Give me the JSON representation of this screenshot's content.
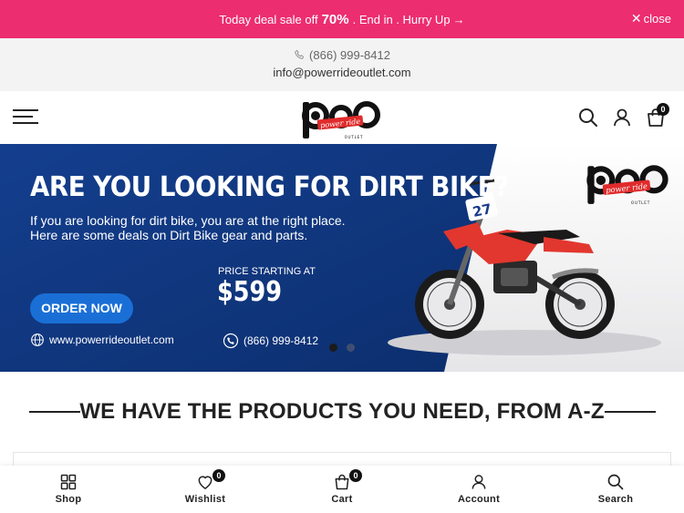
{
  "promo": {
    "text_before": "Today deal sale off",
    "percent": "70%",
    "text_after": ". End in . Hurry Up",
    "arrow": "→",
    "close_label": "close",
    "close_glyph": "✕",
    "bg_color": "#ec2d6f"
  },
  "contact": {
    "phone": "(866) 999-8412",
    "email": "info@powerrideoutlet.com"
  },
  "header": {
    "logo_icon": "power-ride-outlet-logo",
    "cart_count": "0"
  },
  "hero": {
    "headline": "ARE YOU LOOKING FOR DIRT BIKE?",
    "subtext_line1": "If you are looking for dirt bike, you are at the right place.",
    "subtext_line2": "Here are some deals on Dirt Bike gear and parts.",
    "price_label": "PRICE STARTING AT",
    "price": "$599",
    "cta_label": "ORDER NOW",
    "website": "www.powerrideoutlet.com",
    "phone": "(866) 999-8412",
    "bike_number": "27",
    "bg_color": "#0f3a84",
    "cta_color": "#1a6fd6",
    "slide_count": 2,
    "active_slide": 1
  },
  "section": {
    "title": "WE HAVE THE PRODUCTS YOU NEED, FROM A-Z"
  },
  "bottom_nav": {
    "items": [
      {
        "label": "Shop",
        "icon": "grid-icon"
      },
      {
        "label": "Wishlist",
        "icon": "heart-icon",
        "badge": "0"
      },
      {
        "label": "Cart",
        "icon": "bag-icon",
        "badge": "0"
      },
      {
        "label": "Account",
        "icon": "user-icon"
      },
      {
        "label": "Search",
        "icon": "search-icon"
      }
    ]
  }
}
